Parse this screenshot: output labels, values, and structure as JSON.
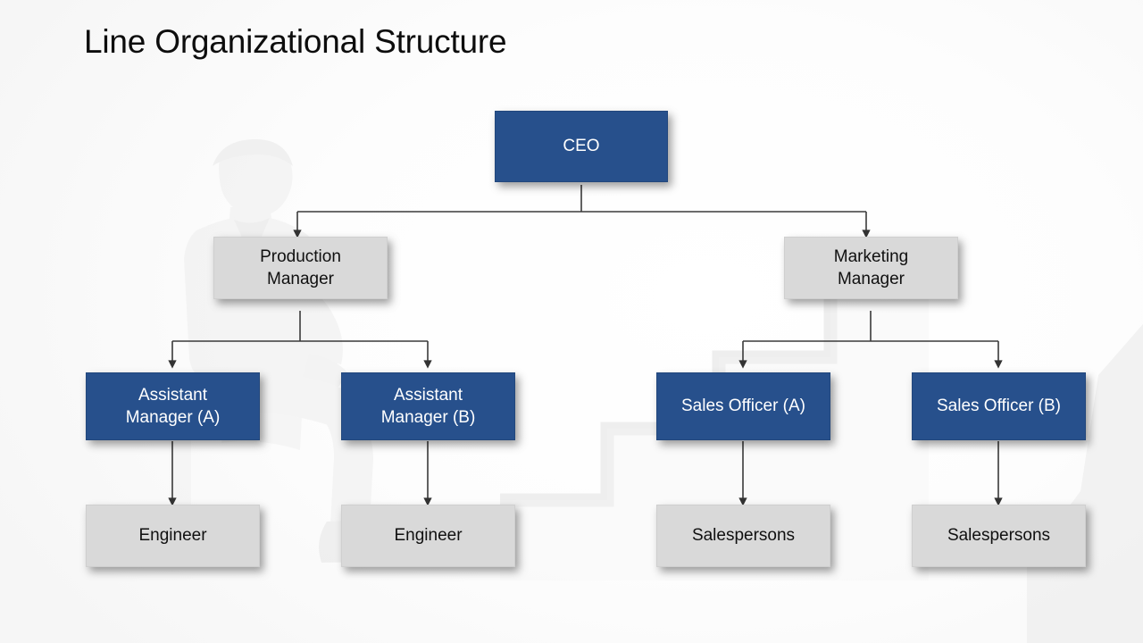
{
  "slide": {
    "title": "Line Organizational Structure",
    "background_color": "#FFFFFF"
  },
  "palette": {
    "accent_blue": "#27508C",
    "box_gray": "#D9D9D9",
    "connector": "#404040",
    "title_text": "#0D0D0D",
    "blue_text": "#FFFFFF",
    "gray_text": "#101010"
  },
  "chart_data": {
    "type": "diagram",
    "diagram_type": "organizational-chart",
    "title": "Line Organizational Structure",
    "levels": 4,
    "nodes": [
      {
        "id": "ceo",
        "label": "CEO",
        "level": 1,
        "style": "blue",
        "parent": null
      },
      {
        "id": "prod",
        "label": "Production\nManager",
        "level": 2,
        "style": "gray",
        "parent": "ceo"
      },
      {
        "id": "mktg",
        "label": "Marketing\nManager",
        "level": 2,
        "style": "gray",
        "parent": "ceo"
      },
      {
        "id": "asma",
        "label": "Assistant\nManager (A)",
        "level": 3,
        "style": "blue",
        "parent": "prod"
      },
      {
        "id": "asmb",
        "label": "Assistant\nManager (B)",
        "level": 3,
        "style": "blue",
        "parent": "prod"
      },
      {
        "id": "soa",
        "label": "Sales Officer (A)",
        "level": 3,
        "style": "blue",
        "parent": "mktg"
      },
      {
        "id": "sob",
        "label": "Sales Officer (B)",
        "level": 3,
        "style": "blue",
        "parent": "mktg"
      },
      {
        "id": "enga",
        "label": "Engineer",
        "level": 4,
        "style": "gray",
        "parent": "asma"
      },
      {
        "id": "engb",
        "label": "Engineer",
        "level": 4,
        "style": "gray",
        "parent": "asmb"
      },
      {
        "id": "spa",
        "label": "Salespersons",
        "level": 4,
        "style": "gray",
        "parent": "soa"
      },
      {
        "id": "spb",
        "label": "Salespersons",
        "level": 4,
        "style": "gray",
        "parent": "sob"
      }
    ],
    "edges": [
      {
        "from": "ceo",
        "to": "prod"
      },
      {
        "from": "ceo",
        "to": "mktg"
      },
      {
        "from": "prod",
        "to": "asma"
      },
      {
        "from": "prod",
        "to": "asmb"
      },
      {
        "from": "mktg",
        "to": "soa"
      },
      {
        "from": "mktg",
        "to": "sob"
      },
      {
        "from": "asma",
        "to": "enga"
      },
      {
        "from": "asmb",
        "to": "engb"
      },
      {
        "from": "soa",
        "to": "spa"
      },
      {
        "from": "sob",
        "to": "spb"
      }
    ]
  },
  "nodes": {
    "ceo": "CEO",
    "production_manager": "Production\nManager",
    "marketing_manager": "Marketing\nManager",
    "assistant_manager_a": "Assistant\nManager (A)",
    "assistant_manager_b": "Assistant\nManager (B)",
    "sales_officer_a": "Sales Officer (A)",
    "sales_officer_b": "Sales Officer (B)",
    "engineer_a": "Engineer",
    "engineer_b": "Engineer",
    "salespersons_a": "Salespersons",
    "salespersons_b": "Salespersons"
  },
  "watermarks": [
    {
      "name": "seated-businessman-silhouette"
    },
    {
      "name": "staircase-steps-shape"
    }
  ]
}
